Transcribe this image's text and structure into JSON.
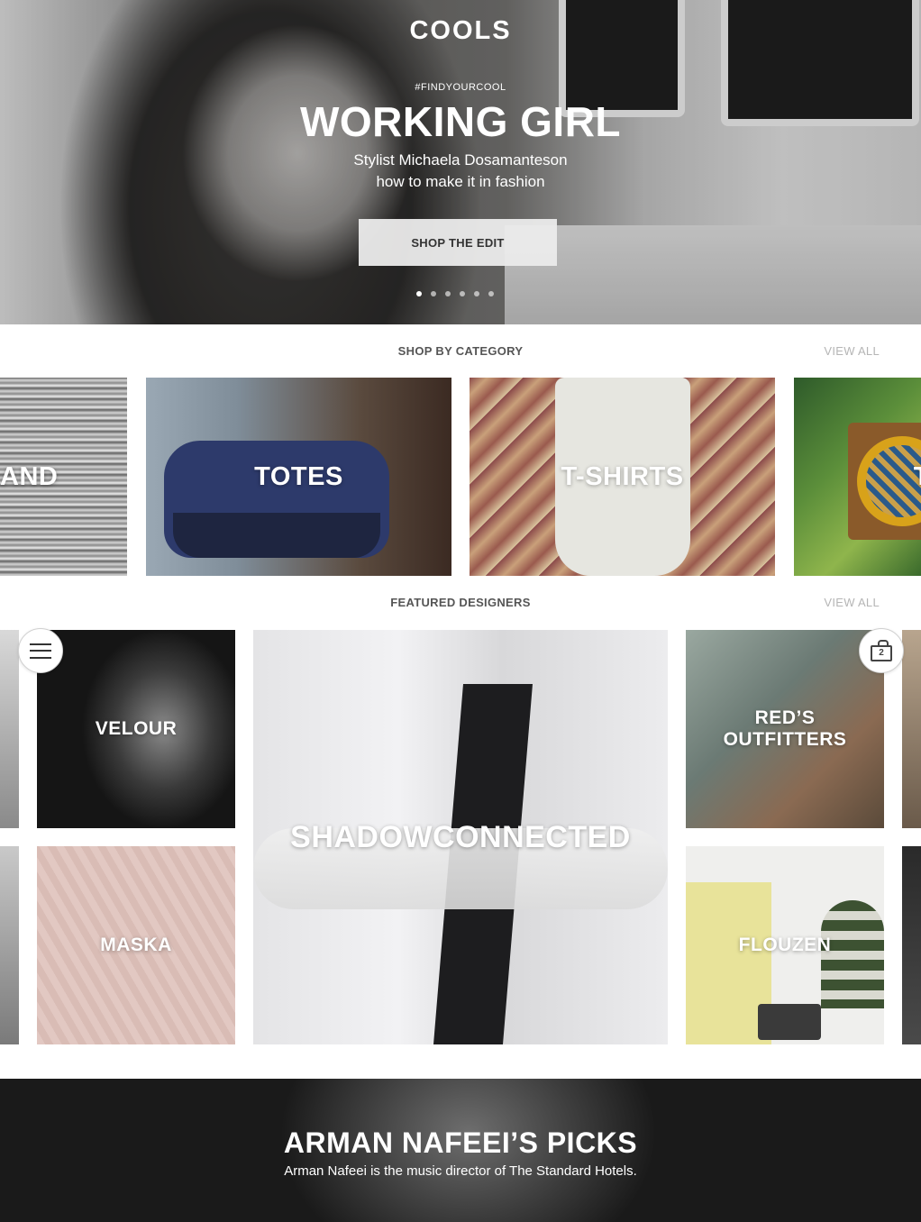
{
  "app": {
    "logo": "COOLS"
  },
  "hero": {
    "hashtag": "#FINDYOURCOOL",
    "title": "WORKING GIRL",
    "subtitle_line1": "Stylist Michaela Dosamanteson",
    "subtitle_line2": "how to make it in fashion",
    "button_label": "SHOP THE EDIT",
    "carousel": {
      "total": 6,
      "active_index": 0
    }
  },
  "categories": {
    "title": "SHOP BY CATEGORY",
    "view_all": "VIEW ALL",
    "items": [
      {
        "label": "AND"
      },
      {
        "label": "TOTES"
      },
      {
        "label": "T-SHIRTS"
      },
      {
        "label": "T"
      }
    ]
  },
  "designers": {
    "title": "FEATURED DESIGNERS",
    "view_all": "VIEW ALL",
    "items": [
      {
        "label": "VELOUR"
      },
      {
        "label": "MASKA"
      },
      {
        "label": "SHADOWCONNECTED"
      },
      {
        "label_line1": "RED’S",
        "label_line2": "OUTFITTERS"
      },
      {
        "label": "FLOUZEN"
      }
    ]
  },
  "floating": {
    "menu_icon": "hamburger-menu-icon",
    "bag_icon": "shopping-bag-icon",
    "bag_count": "2"
  },
  "picks": {
    "title": "ARMAN NAFEEI’S PICKS",
    "subtitle": "Arman Nafeei is the music director of The Standard Hotels."
  },
  "colors": {
    "view_all": "#b5b5b5",
    "section_title": "#555555",
    "button_bg": "#ebebeb",
    "banner_bg": "#161616"
  }
}
